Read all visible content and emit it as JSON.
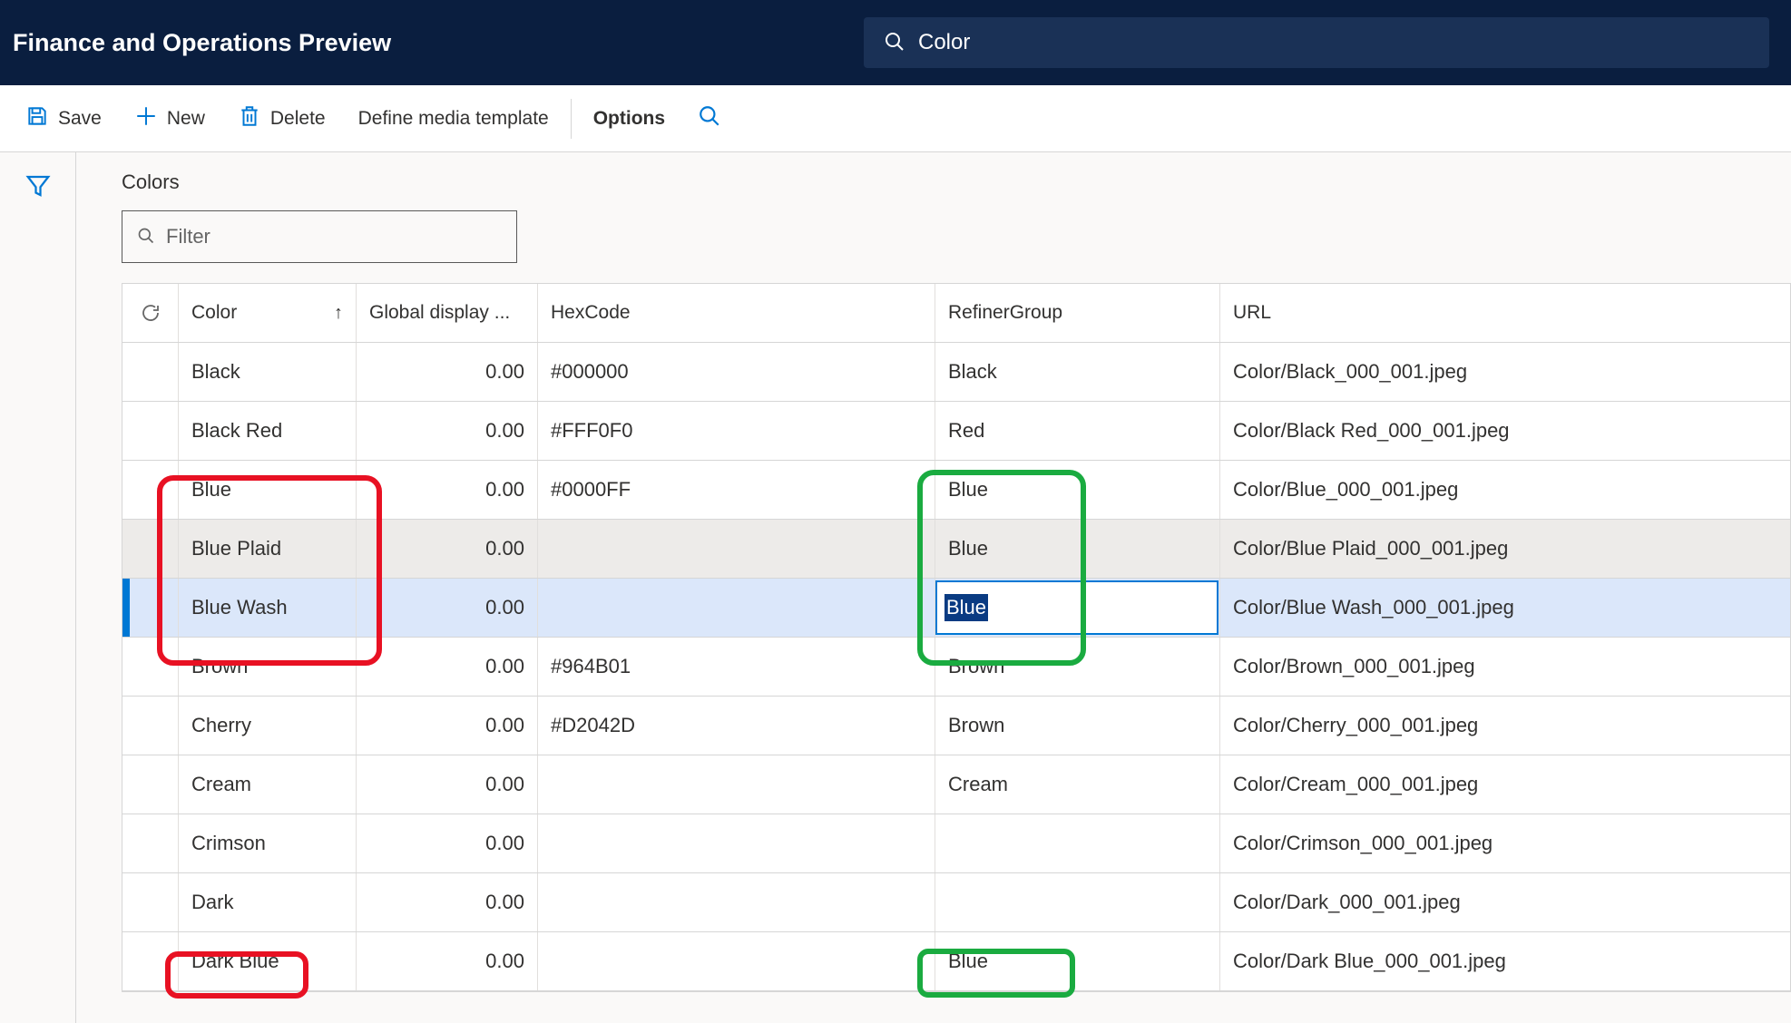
{
  "header": {
    "app_title": "Finance and Operations Preview",
    "search_value": "Color"
  },
  "toolbar": {
    "save": "Save",
    "new": "New",
    "delete": "Delete",
    "define_media_template": "Define media template",
    "options": "Options"
  },
  "section": {
    "title": "Colors",
    "filter_placeholder": "Filter"
  },
  "columns": {
    "color": "Color",
    "global_display": "Global display ...",
    "hexcode": "HexCode",
    "refiner_group": "RefinerGroup",
    "url": "URL"
  },
  "rows": [
    {
      "color": "Black",
      "gd": "0.00",
      "hex": "#000000",
      "rg": "Black",
      "url": "Color/Black_000_001.jpeg"
    },
    {
      "color": "Black Red",
      "gd": "0.00",
      "hex": "#FFF0F0",
      "rg": "Red",
      "url": "Color/Black Red_000_001.jpeg"
    },
    {
      "color": "Blue",
      "gd": "0.00",
      "hex": "#0000FF",
      "rg": "Blue",
      "url": "Color/Blue_000_001.jpeg"
    },
    {
      "color": "Blue Plaid",
      "gd": "0.00",
      "hex": "",
      "rg": "Blue",
      "url": "Color/Blue Plaid_000_001.jpeg"
    },
    {
      "color": "Blue Wash",
      "gd": "0.00",
      "hex": "",
      "rg": "Blue",
      "url": "Color/Blue Wash_000_001.jpeg"
    },
    {
      "color": "Brown",
      "gd": "0.00",
      "hex": "#964B01",
      "rg": "Brown",
      "url": "Color/Brown_000_001.jpeg"
    },
    {
      "color": "Cherry",
      "gd": "0.00",
      "hex": "#D2042D",
      "rg": "Brown",
      "url": "Color/Cherry_000_001.jpeg"
    },
    {
      "color": "Cream",
      "gd": "0.00",
      "hex": "",
      "rg": "Cream",
      "url": "Color/Cream_000_001.jpeg"
    },
    {
      "color": "Crimson",
      "gd": "0.00",
      "hex": "",
      "rg": "",
      "url": "Color/Crimson_000_001.jpeg"
    },
    {
      "color": "Dark",
      "gd": "0.00",
      "hex": "",
      "rg": "",
      "url": "Color/Dark_000_001.jpeg"
    },
    {
      "color": "Dark Blue",
      "gd": "0.00",
      "hex": "",
      "rg": "Blue",
      "url": "Color/Dark Blue_000_001.jpeg"
    }
  ],
  "selected_row_index": 4,
  "alt_row_index": 3,
  "editing": {
    "row_index": 4,
    "value": "Blue"
  }
}
